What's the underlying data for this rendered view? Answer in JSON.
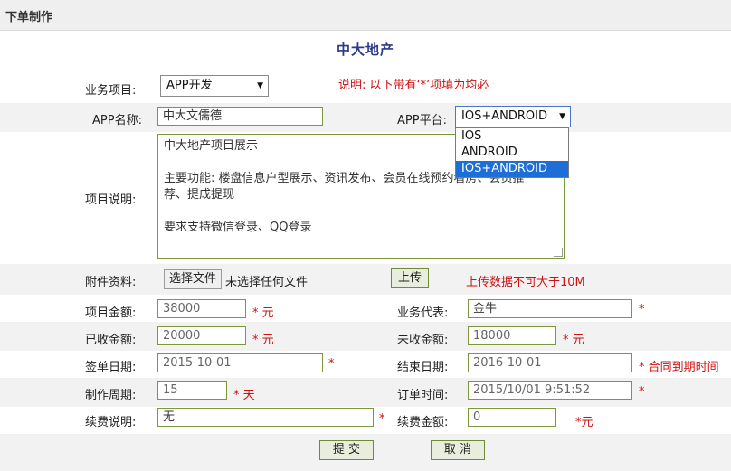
{
  "header": {
    "title": "下单制作"
  },
  "page_title": "中大地产",
  "business": {
    "label": "业务项目:",
    "value": "APP开发",
    "note": "说明: 以下带有‘*’项填为均必"
  },
  "app": {
    "name_label": "APP名称:",
    "name_value": "中大文儒德",
    "platform_label": "APP平台:",
    "platform_value": "IOS+ANDROID",
    "platform_options": [
      "IOS",
      "ANDROID",
      "IOS+ANDROID"
    ]
  },
  "description": {
    "label": "项目说明:",
    "line1": "中大地产项目展示",
    "line2": "主要功能: 楼盘信息户型展示、资讯发布、会员在线预约看房、会员推",
    "line3": "荐、提成提现",
    "line4": "要求支持微信登录、QQ登录"
  },
  "attachment": {
    "label": "附件资料:",
    "choose_button": "选择文件",
    "no_file": "未选择任何文件",
    "upload_button": "上传",
    "note": "上传数据不可大于10M"
  },
  "fields": {
    "amount_label": "项目金额:",
    "amount_value": "38000",
    "amount_unit": "* 元",
    "rep_label": "业务代表:",
    "rep_value": "金牛",
    "rep_star": "*",
    "received_label": "已收金额:",
    "received_value": "20000",
    "received_unit": "* 元",
    "unreceived_label": "未收金额:",
    "unreceived_value": "18000",
    "unreceived_unit": "* 元",
    "sign_label": "签单日期:",
    "sign_value": "2015-10-01",
    "sign_star": "*",
    "end_label": "结束日期:",
    "end_value": "2016-10-01",
    "end_note": "* 合同到期时间",
    "period_label": "制作周期:",
    "period_value": "15",
    "period_unit": "* 天",
    "order_label": "订单时间:",
    "order_value": "2015/10/01 9:51:52",
    "order_star": "*",
    "renew_desc_label": "续费说明:",
    "renew_desc_value": "无",
    "renew_desc_star": "*",
    "renew_amount_label": "续费金额:",
    "renew_amount_value": "0",
    "renew_amount_unit": "*元"
  },
  "actions": {
    "submit": "提 交",
    "cancel": "取 消"
  }
}
